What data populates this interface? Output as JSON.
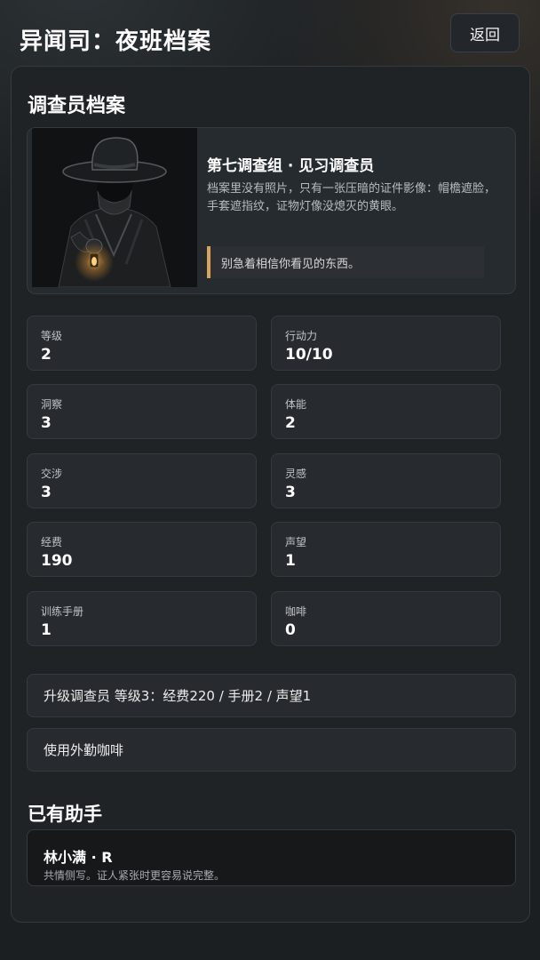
{
  "app": {
    "title": "异闻司：夜班档案",
    "back_label": "返回"
  },
  "profile": {
    "section_title": "调查员档案",
    "name": "第七调查组 · 见习调查员",
    "description": "档案里没有照片，只有一张压暗的证件影像：帽檐遮脸，手套遮指纹，证物灯像没熄灭的黄眼。",
    "quote": "别急着相信你看见的东西。",
    "accent_color": "#d9a458"
  },
  "stats": [
    {
      "label": "等级",
      "value": "2"
    },
    {
      "label": "行动力",
      "value": "10/10"
    },
    {
      "label": "洞察",
      "value": "3"
    },
    {
      "label": "体能",
      "value": "2"
    },
    {
      "label": "交涉",
      "value": "3"
    },
    {
      "label": "灵感",
      "value": "3"
    },
    {
      "label": "经费",
      "value": "190"
    },
    {
      "label": "声望",
      "value": "1"
    },
    {
      "label": "训练手册",
      "value": "1"
    },
    {
      "label": "咖啡",
      "value": "0"
    }
  ],
  "actions": {
    "upgrade_label": "升级调查员 等级3：经费220 / 手册2 / 声望1",
    "coffee_label": "使用外勤咖啡"
  },
  "helpers": {
    "section_title": "已有助手",
    "items": [
      {
        "name": "林小满 · R",
        "description": "共情侧写。证人紧张时更容易说完整。"
      }
    ]
  }
}
